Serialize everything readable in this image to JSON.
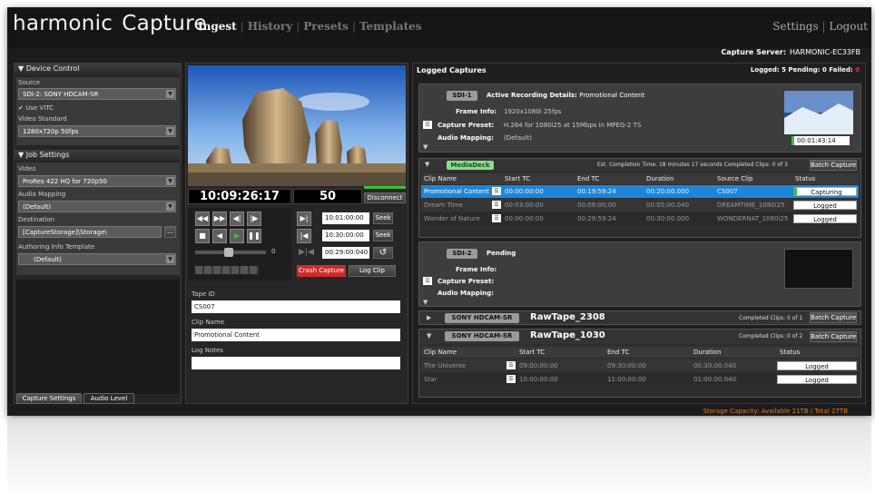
{
  "header": {
    "brand": "harmonic",
    "product": "Capture",
    "nav": [
      "Ingest",
      "History",
      "Presets",
      "Templates"
    ],
    "settings": "Settings",
    "logout": "Logout",
    "server_label": "Capture Server:",
    "server_name": "HARMONIC-EC33FB"
  },
  "left": {
    "device_title": "Device Control",
    "source_label": "Source",
    "source_value": "SDI-2: SONY HDCAM-SR",
    "use_vitc": "Use VITC",
    "video_std_label": "Video Standard",
    "video_std_value": "1280x720p 50fps",
    "job_title": "Job Settings",
    "video_label": "Video",
    "video_value": "ProRes 422 HQ for 720p50",
    "audio_label": "Audio Mapping",
    "audio_value": "(Default)",
    "dest_label": "Destination",
    "dest_value": "[CaptureStorage]\\Storage\\",
    "dest_btn": "...",
    "auth_label": "Authoring Info Template",
    "auth_value": "(Default)",
    "tab1": "Capture Settings",
    "tab2": "Audio Level"
  },
  "center": {
    "timecode": "10:09:26:17",
    "frame": "50",
    "disconnect": "Disconnect",
    "slider_val": "0",
    "tc_in": "10:01:00:00",
    "tc_out": "10:30:00:00",
    "tc_dur": "00:29:00:040",
    "seek": "Seek",
    "crash": "Crash Capture",
    "log_clip": "Log Clip",
    "tape_id_label": "Tape ID",
    "tape_id": "CS007",
    "clip_name_label": "Clip Name",
    "clip_name": "Promotional Content",
    "log_notes_label": "Log Notes",
    "log_notes": ""
  },
  "right": {
    "title": "Logged Captures",
    "counts": "Logged: 5 Pending: 0 Failed:",
    "failed": "0",
    "sdi1": {
      "badge": "SDI-1",
      "heading": "Active Recording Details:",
      "heading_value": "Promotional Content",
      "fi_label": "Frame Info:",
      "fi": "1920x1080i 25fps",
      "cp_label": "Capture Preset:",
      "cp": "H.264 for 1080i25 at 15Mbps in MPEG-2 TS",
      "am_label": "Audio Mapping:",
      "am": "(Default)",
      "tc": "00:01:43:14"
    },
    "md": {
      "badge": "MediaDeck",
      "est": "Est. Completion Time: 18 minutes 17 seconds  Completed Clips: 0 of 3",
      "batch": "Batch Capture",
      "headers": [
        "Clip Name",
        "Start TC",
        "End TC",
        "Duration",
        "Source Clip",
        "Status"
      ],
      "rows": [
        {
          "name": "Promotional Content",
          "start": "00:00:00:00",
          "end": "00:19:59:24",
          "dur": "00:20:00.000",
          "src": "CS007",
          "status": "Capturing"
        },
        {
          "name": "Dream Time",
          "start": "00:03:00:00",
          "end": "00:08:00:00",
          "dur": "00:05:00.040",
          "src": "DREAMTIME_1080i25",
          "status": "Logged"
        },
        {
          "name": "Wonder of Nature",
          "start": "00:00:00:00",
          "end": "00:29:59:24",
          "dur": "00:30:00.000",
          "src": "WONDERNAT_1080i25",
          "status": "Logged"
        }
      ]
    },
    "sdi2": {
      "badge": "SDI-2",
      "heading": "Pending",
      "fi_label": "Frame Info:",
      "cp_label": "Capture Preset:",
      "am_label": "Audio Mapping:"
    },
    "tape1": {
      "badge": "SONY HDCAM-SR",
      "name": "RawTape_2308",
      "completed": "Completed Clips: 0 of 1",
      "batch": "Batch Capture"
    },
    "tape2": {
      "badge": "SONY HDCAM-SR",
      "name": "RawTape_1030",
      "completed": "Completed Clips: 0 of 2",
      "batch": "Batch Capture",
      "headers": [
        "Clip Name",
        "Start TC",
        "End TC",
        "Duration",
        "Status"
      ],
      "rows": [
        {
          "name": "The Universe",
          "start": "09:00:00:00",
          "end": "09:30:00:00",
          "dur": "00:30:00.040",
          "status": "Logged"
        },
        {
          "name": "Star",
          "start": "10:00:00:00",
          "end": "11:00:00:00",
          "dur": "01:00:00.040",
          "status": "Logged"
        }
      ]
    },
    "storage": "Storage Capacity: Available 21TB / Total 27TB"
  },
  "colors": {
    "accent": "#1e86d8",
    "crash": "#d02a2a",
    "green": "#3cbf3c",
    "storage": "#e07b1e"
  },
  "icons": [
    "triangle-down-icon",
    "rewind-icon",
    "fast-forward-icon",
    "step-back-icon",
    "step-forward-icon",
    "stop-icon",
    "play-reverse-icon",
    "play-icon",
    "pause-icon",
    "mark-in-icon",
    "mark-out-icon",
    "undo-icon",
    "clip-icon"
  ]
}
